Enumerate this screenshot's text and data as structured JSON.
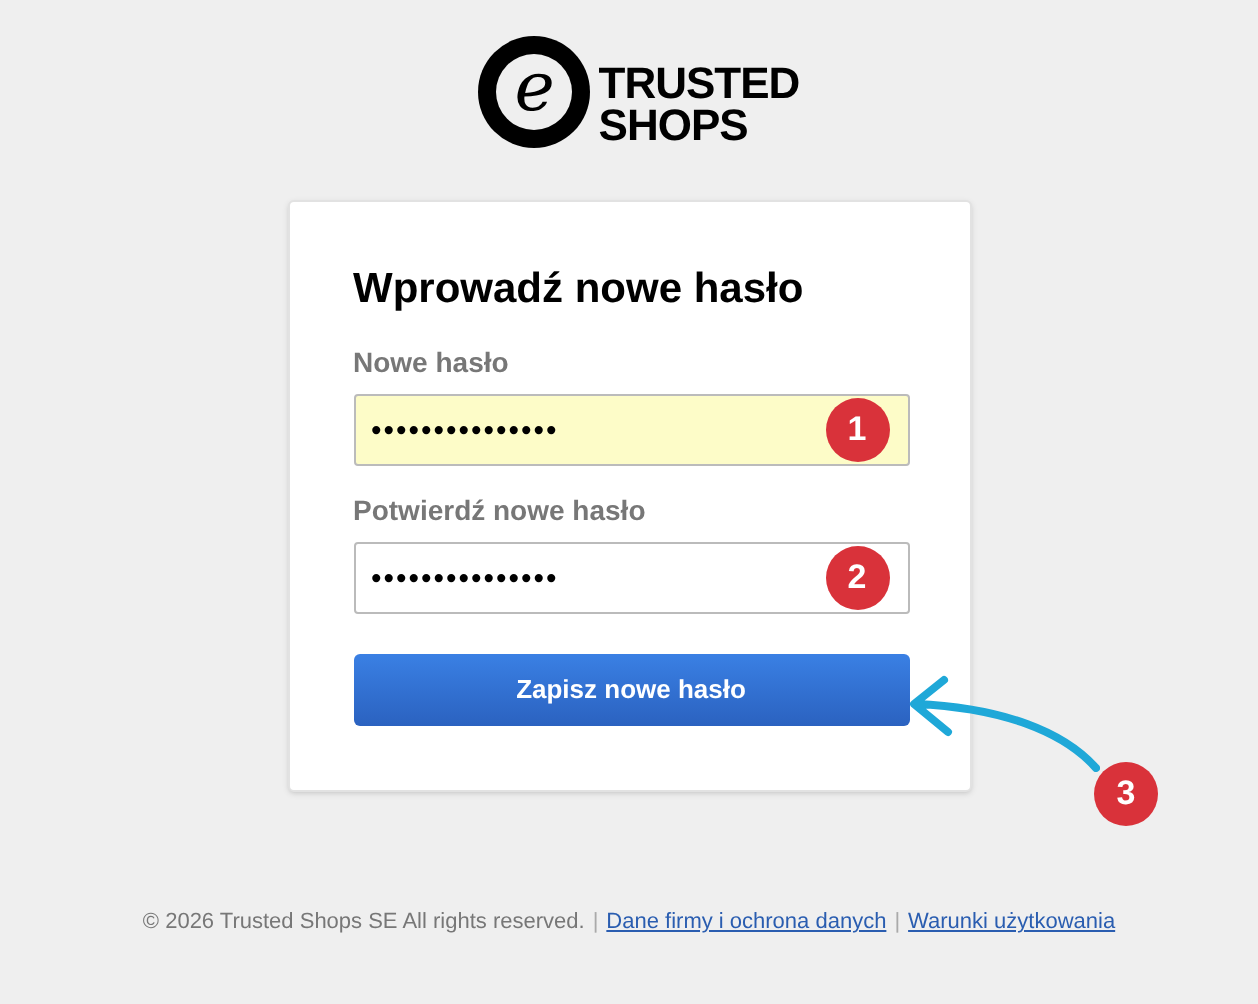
{
  "logo": {
    "mark": "e",
    "line_1": "TRUSTED",
    "line_2": "SHOPS"
  },
  "form": {
    "title": "Wprowadź nowe hasło",
    "fields": [
      {
        "label": "Nowe hasło",
        "value": "•••••••••••••••",
        "autofilled": true,
        "badge": "1"
      },
      {
        "label": "Potwierdź nowe hasło",
        "value": "•••••••••••••••",
        "autofilled": false,
        "badge": "2"
      }
    ],
    "submit": {
      "label": "Zapisz nowe hasło",
      "badge": "3"
    }
  },
  "footer": {
    "copyright": "© 2026 Trusted Shops SE All rights reserved.",
    "separator": "|",
    "links": [
      "Dane firmy i ochrona danych",
      "Warunki użytkowania"
    ]
  }
}
